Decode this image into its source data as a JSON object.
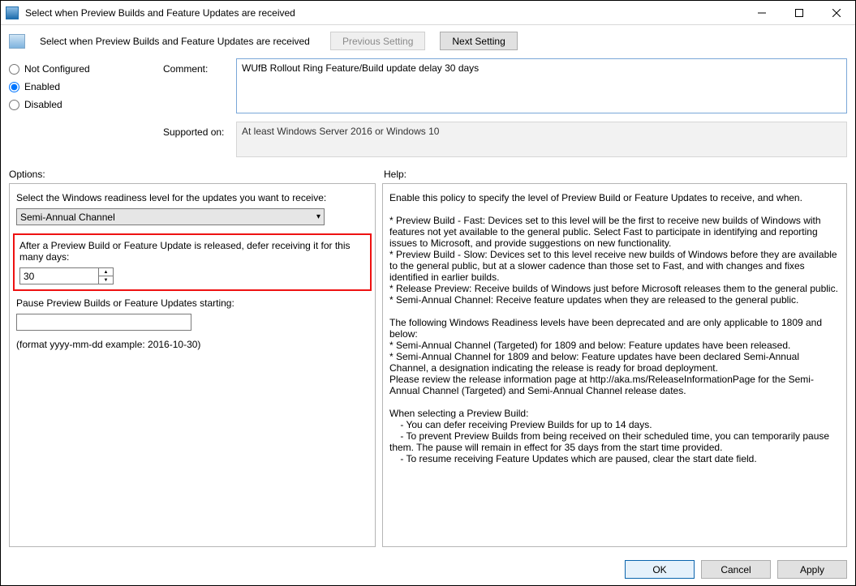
{
  "titlebar": {
    "title": "Select when Preview Builds and Feature Updates are received"
  },
  "header": {
    "title": "Select when Preview Builds and Feature Updates are received",
    "prev": "Previous Setting",
    "next": "Next Setting"
  },
  "state": {
    "not_configured": "Not Configured",
    "enabled": "Enabled",
    "disabled": "Disabled",
    "selected": "enabled"
  },
  "labels": {
    "comment": "Comment:",
    "supported": "Supported on:",
    "options": "Options:",
    "help": "Help:"
  },
  "comment": "WUfB Rollout Ring Feature/Build update delay 30 days",
  "supported": "At least Windows Server 2016 or Windows 10",
  "options": {
    "readiness_label": "Select the Windows readiness level for the updates you want to receive:",
    "readiness_value": "Semi-Annual Channel",
    "defer_label": "After a Preview Build or Feature Update is released, defer receiving it for this many days:",
    "defer_value": "30",
    "pause_label": "Pause Preview Builds or Feature Updates starting:",
    "pause_value": "",
    "format_hint": "(format yyyy-mm-dd example: 2016-10-30)"
  },
  "help_text": "Enable this policy to specify the level of Preview Build or Feature Updates to receive, and when.\n\n* Preview Build - Fast: Devices set to this level will be the first to receive new builds of Windows with features not yet available to the general public. Select Fast to participate in identifying and reporting issues to Microsoft, and provide suggestions on new functionality.\n* Preview Build - Slow: Devices set to this level receive new builds of Windows before they are available to the general public, but at a slower cadence than those set to Fast, and with changes and fixes identified in earlier builds.\n* Release Preview: Receive builds of Windows just before Microsoft releases them to the general public.\n* Semi-Annual Channel: Receive feature updates when they are released to the general public.\n\nThe following Windows Readiness levels have been deprecated and are only applicable to 1809 and below:\n* Semi-Annual Channel (Targeted) for 1809 and below: Feature updates have been released.\n* Semi-Annual Channel for 1809 and below: Feature updates have been declared Semi-Annual Channel, a designation indicating the release is ready for broad deployment.\nPlease review the release information page at http://aka.ms/ReleaseInformationPage for the Semi-Annual Channel (Targeted) and Semi-Annual Channel release dates.\n\nWhen selecting a Preview Build:\n    - You can defer receiving Preview Builds for up to 14 days.\n    - To prevent Preview Builds from being received on their scheduled time, you can temporarily pause them. The pause will remain in effect for 35 days from the start time provided.\n    - To resume receiving Feature Updates which are paused, clear the start date field.",
  "footer": {
    "ok": "OK",
    "cancel": "Cancel",
    "apply": "Apply"
  }
}
